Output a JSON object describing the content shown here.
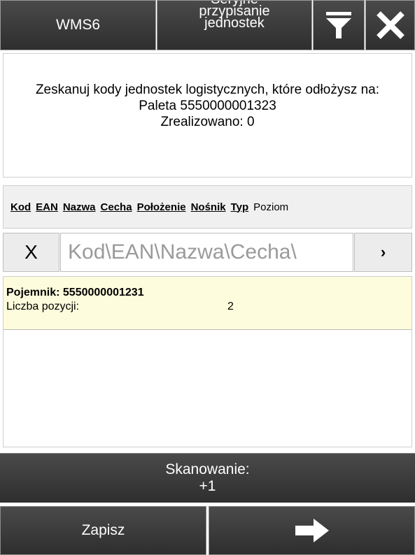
{
  "header": {
    "app_label": "WMS6",
    "title_line1": "Seryjne",
    "title_line2": "przypisanie",
    "title_line3": "jednostek",
    "filter_icon": "filter-icon",
    "close_icon": "close-icon"
  },
  "info": {
    "instruction": "Zeskanuj kody jednostek logistycznych, które odłożysz na:",
    "target": "Paleta 5550000001323",
    "realized": "Zrealizowano: 0"
  },
  "columns": [
    "Kod",
    "EAN",
    "Nazwa",
    "Cecha",
    "Położenie",
    "Nośnik",
    "Typ",
    "Poziom"
  ],
  "search": {
    "clear_label": "X",
    "placeholder": "Kod\\EAN\\Nazwa\\Cecha\\",
    "next_label": "›"
  },
  "list": {
    "items": [
      {
        "title": "Pojemnik: 5550000001231",
        "count_label": "Liczba pozycji:",
        "count_value": "2"
      }
    ]
  },
  "bottom": {
    "scan_line1": "Skanowanie:",
    "scan_line2": "+1",
    "save_label": "Zapisz",
    "next_icon": "arrow-right-icon"
  },
  "colors": {
    "toolbar_dark": "#3a3a3a",
    "row_highlight": "#fdfcdc"
  }
}
